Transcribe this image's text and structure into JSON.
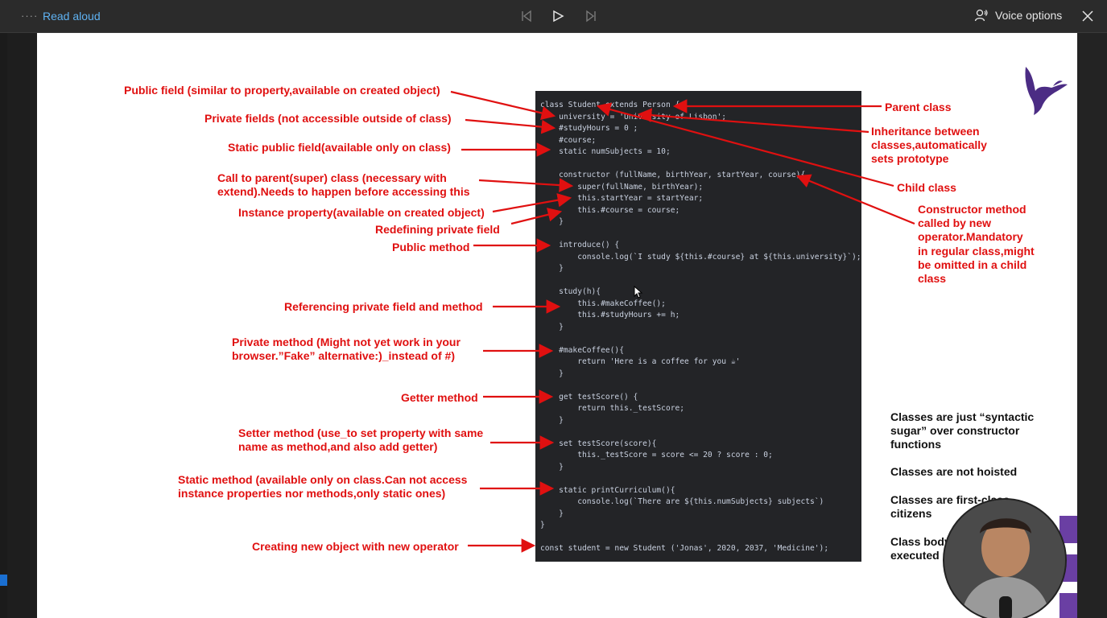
{
  "toolbar": {
    "menu_dots": "····",
    "title": "Read aloud",
    "voice_options": "Voice options"
  },
  "annotations_left": [
    "Public field (similar to property,available on created object)",
    "Private fields (not accessible outside of class)",
    "Static public field(available only on class)",
    "Call to parent(super) class (necessary with",
    "extend).Needs to happen before accessing this",
    "Instance property(available on created object)",
    "Redefining private field",
    "Public method",
    "Referencing private field and method",
    "Private method (Might not yet work in your",
    "browser.”Fake” alternative:)_instead of #)",
    "Getter method",
    "Setter method (use_to set property with same",
    "name as method,and also add getter)",
    "Static method (available only on class.Can not access",
    "instance properties nor methods,only static ones)",
    "Creating new object with new operator"
  ],
  "annotations_right": {
    "parent_class": "Parent class",
    "inheritance": [
      "Inheritance between",
      "classes,automatically",
      "sets prototype"
    ],
    "child_class": "Child class",
    "constructor": [
      "Constructor method",
      "called by new",
      "operator.Mandatory",
      "in regular class,might",
      "be omitted in a child",
      "class"
    ]
  },
  "info_notes": [
    [
      "Classes are just “syntactic",
      "sugar” over constructor",
      "functions"
    ],
    [
      "Classes are not hoisted"
    ],
    [
      "Classes are first-class",
      "citizens"
    ],
    [
      "Class body",
      "executed"
    ]
  ],
  "code_lines": [
    "class Student extends Person {",
    "    university = 'University of Lisbon';",
    "    #studyHours = 0 ;",
    "    #course;",
    "    static numSubjects = 10;",
    "",
    "    constructor (fullName, birthYear, startYear, course){",
    "        super(fullName, birthYear);",
    "        this.startYear = startYear;",
    "        this.#course = course;",
    "    }",
    "",
    "    introduce() {",
    "        console.log(`I study ${this.#course} at ${this.university}`);",
    "    }",
    "",
    "    study(h){",
    "        this.#makeCoffee();",
    "        this.#studyHours += h;",
    "    }",
    "",
    "    #makeCoffee(){",
    "        return 'Here is a coffee for you ☕'",
    "    }",
    "",
    "    get testScore() {",
    "        return this._testScore;",
    "    }",
    "",
    "    set testScore(score){",
    "        this._testScore = score <= 20 ? score : 0;",
    "    }",
    "",
    "    static printCurriculum(){",
    "        console.log(`There are ${this.numSubjects} subjects`)",
    "    }",
    "}",
    "",
    "const student = new Student ('Jonas', 2020, 2037, 'Medicine');"
  ],
  "colors": {
    "annotation": "#e01010",
    "accent_link": "#5fb2f2",
    "code_bg": "#232427",
    "logo": "#4b2c84"
  },
  "icons": {
    "prev": "skip-previous-icon",
    "play": "play-icon",
    "next": "skip-next-icon",
    "voice": "voice-icon",
    "close": "close-icon",
    "logo": "bird-logo-icon"
  }
}
